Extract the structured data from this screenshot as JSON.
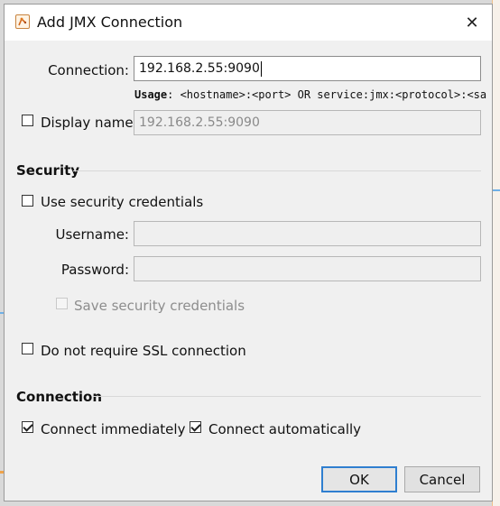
{
  "window": {
    "title": "Add JMX Connection",
    "close_glyph": "✕",
    "icon": "app-icon"
  },
  "connection": {
    "label": "Connection:",
    "value": "192.168.2.55:9090",
    "usage_prefix": "Usage",
    "usage_text": ": <hostname>:<port> OR service:jmx:<protocol>:<sap"
  },
  "display_name": {
    "label": "Display name:",
    "checked": false,
    "value": "192.168.2.55:9090"
  },
  "security": {
    "title": "Security",
    "use_credentials_label": "Use security credentials",
    "use_credentials_checked": false,
    "username_label": "Username:",
    "username_value": "",
    "password_label": "Password:",
    "password_value": "",
    "save_credentials_label": "Save security credentials",
    "save_credentials_checked": false,
    "ssl_label": "Do not require SSL connection",
    "ssl_checked": false
  },
  "connection_section": {
    "title": "Connection",
    "connect_immediately_label": "Connect immediately",
    "connect_immediately_checked": true,
    "connect_automatically_label": "Connect automatically",
    "connect_automatically_checked": true
  },
  "buttons": {
    "ok": "OK",
    "cancel": "Cancel"
  },
  "colors": {
    "dialog_bg": "#f0f0f0",
    "titlebar_bg": "#ffffff",
    "ok_border": "#2f7fd0"
  }
}
